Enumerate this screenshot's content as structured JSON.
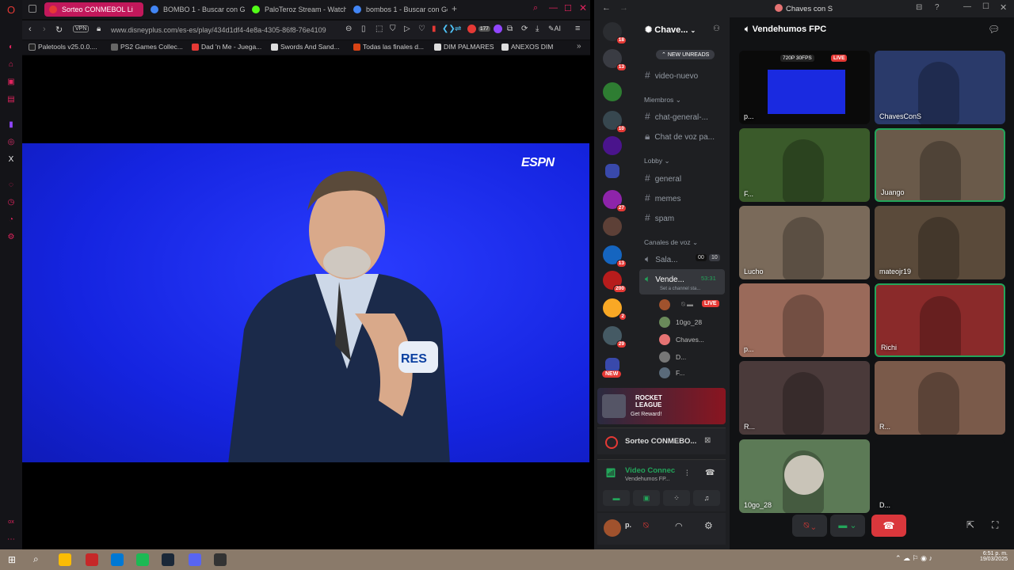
{
  "browser": {
    "tabs": [
      {
        "label": "Sorteo CONMEBOL Li",
        "active": true,
        "color": "#e53935"
      },
      {
        "label": "BOMBO 1 - Buscar con Go",
        "active": false,
        "color": "#4285f4"
      },
      {
        "label": "PaloTeroz Stream - Watch",
        "active": false,
        "color": "#53fc18"
      },
      {
        "label": "bombos 1 - Buscar con Go",
        "active": false,
        "color": "#4285f4"
      }
    ],
    "vpn_label": "VPN",
    "url": "www.disneyplus.com/es-es/play/434d1df4-4e8a-4305-86f8-76e4109",
    "ext_badge": "177",
    "ai_label": "AI",
    "bookmarks": [
      "Paletools v25.0.0....",
      "PS2 Games Collec...",
      "Dad 'n Me - Juega...",
      "Swords And Sand...",
      "Todas las finales d...",
      "DIM PALMARES",
      "ANEXOS DIM"
    ],
    "video_logo": "ESPN",
    "armband_text": "RES"
  },
  "discord": {
    "window_title": "Chaves con S",
    "server_name": "Chave...",
    "voice_channel_title": "Vendehumos FPC",
    "guild_badges": [
      "18",
      "13",
      "10",
      "27",
      "13",
      "200",
      "2",
      "29"
    ],
    "new_label": "NEW",
    "new_unreads": "NEW UNREADS",
    "channels_top": [
      "video-nuevo"
    ],
    "cat_members": "Miembros",
    "members_channels": [
      "chat-general-...",
      "Chat de voz pa..."
    ],
    "cat_lobby": "Lobby",
    "lobby_channels": [
      "general",
      "memes",
      "spam"
    ],
    "cat_voice": "Canales de voz",
    "voice_sala": "Sala...",
    "sala_counts": [
      "00",
      "10"
    ],
    "voice_active": "Vende...",
    "voice_timer": "53:31",
    "channel_status": "Set a channel sta...",
    "voice_users": [
      "",
      "10go_28",
      "Chaves...",
      "D...",
      "F..."
    ],
    "live_label": "LIVE",
    "promo_title": "ROCKET LEAGUE",
    "promo_sub": "Get Reward!",
    "activity_title": "Sorteo CONMEBO...",
    "video_connected": "Video Connec",
    "video_sub": "Vendehumos FP...",
    "user_name": "p.",
    "tiles": [
      {
        "label": "p...",
        "bg": "#0a0a0a",
        "badge": "720P 30FPS"
      },
      {
        "label": "ChavesConS",
        "bg": "#2a3a6a"
      },
      {
        "label": "F...",
        "bg": "#3a5a2a"
      },
      {
        "label": "Juango",
        "bg": "#6a5a4a"
      },
      {
        "label": "Lucho",
        "bg": "#7a6a5a"
      },
      {
        "label": "mateojr19",
        "bg": "#5a4a3a"
      },
      {
        "label": "p...",
        "bg": "#9a6a5a"
      },
      {
        "label": "Richi",
        "bg": "#8a2a2a"
      },
      {
        "label": "R...",
        "bg": "#4a3a3a"
      },
      {
        "label": "R...",
        "bg": "#7a5a4a"
      },
      {
        "label": "10go_28",
        "bg": "#5c7a56"
      },
      {
        "label": "D...",
        "bg": "#111214"
      }
    ]
  },
  "taskbar": {
    "time": "6:51 p. m.",
    "date": "19/03/2025"
  }
}
